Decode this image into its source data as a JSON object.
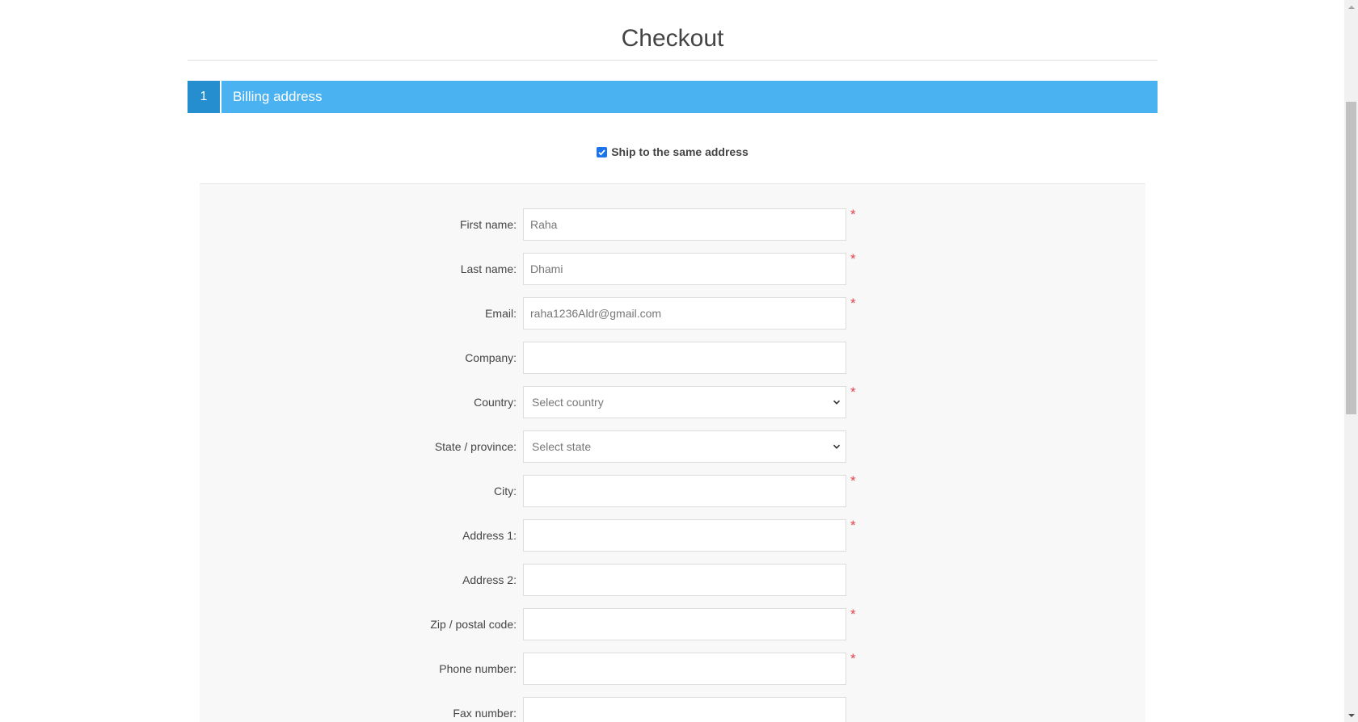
{
  "page": {
    "title": "Checkout"
  },
  "step": {
    "number": "1",
    "title": "Billing address"
  },
  "ship_same": {
    "label": "Ship to the same address",
    "checked": true
  },
  "form": {
    "required_marker": "*",
    "fields": [
      {
        "label": "First name:",
        "value": "Raha",
        "required": true,
        "type": "text"
      },
      {
        "label": "Last name:",
        "value": "Dhami",
        "required": true,
        "type": "text"
      },
      {
        "label": "Email:",
        "value": "raha1236Aldr@gmail.com",
        "required": true,
        "type": "text"
      },
      {
        "label": "Company:",
        "value": "",
        "required": false,
        "type": "text"
      },
      {
        "label": "Country:",
        "value": "Select country",
        "required": true,
        "type": "select"
      },
      {
        "label": "State / province:",
        "value": "Select state",
        "required": false,
        "type": "select"
      },
      {
        "label": "City:",
        "value": "",
        "required": true,
        "type": "text"
      },
      {
        "label": "Address 1:",
        "value": "",
        "required": true,
        "type": "text"
      },
      {
        "label": "Address 2:",
        "value": "",
        "required": false,
        "type": "text"
      },
      {
        "label": "Zip / postal code:",
        "value": "",
        "required": true,
        "type": "text"
      },
      {
        "label": "Phone number:",
        "value": "",
        "required": true,
        "type": "text"
      },
      {
        "label": "Fax number:",
        "value": "",
        "required": false,
        "type": "text"
      }
    ]
  },
  "colors": {
    "step_bar": "#4ab2f1",
    "step_number_bg": "#248ece",
    "required": "#e4434b",
    "panel_bg": "#f8f8f8"
  }
}
